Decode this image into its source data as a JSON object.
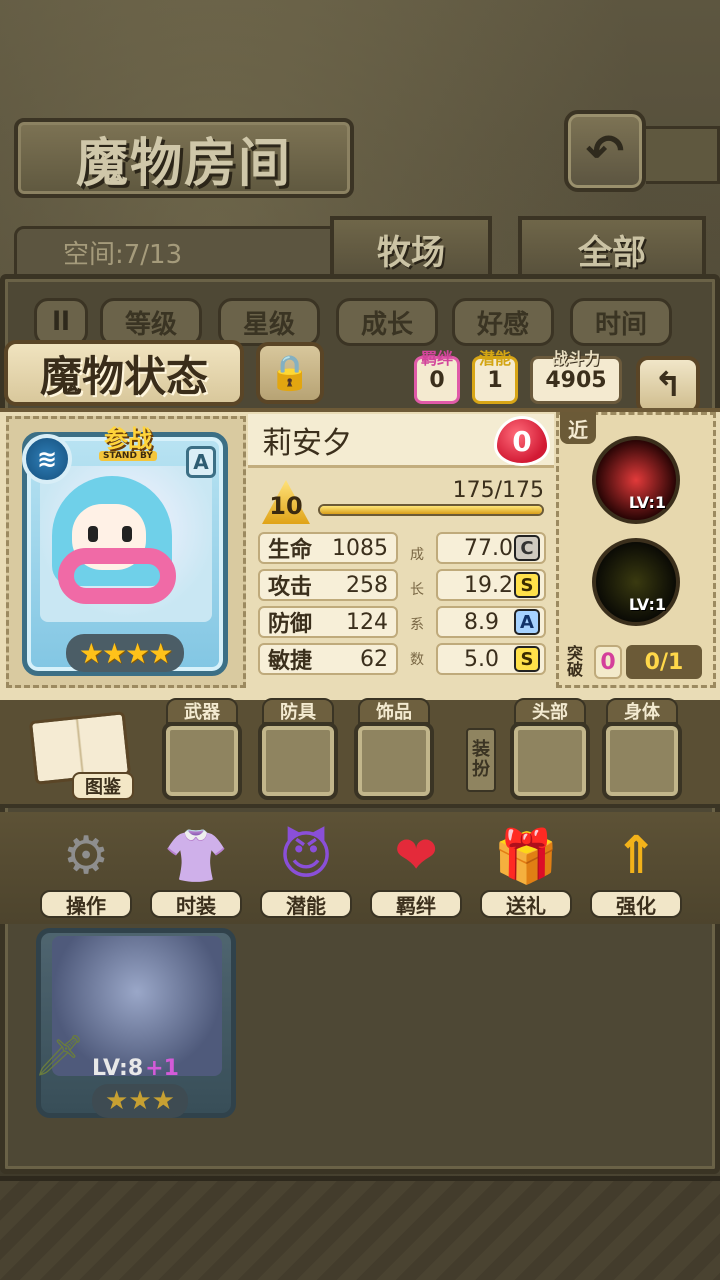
{
  "title": "魔物房间",
  "space": "空间:7/13",
  "tabs": {
    "ranch": "牧场",
    "all": "全部"
  },
  "sort_buttons": [
    "等级",
    "星级",
    "成长",
    "好感",
    "时间"
  ],
  "status_title": "魔物状态",
  "bond": {
    "label": "羁绊",
    "value": "0"
  },
  "potential": {
    "label": "潜能",
    "value": "1"
  },
  "power": {
    "label": "战斗力",
    "value": "4905"
  },
  "card": {
    "standby_cn": "参战",
    "standby_en": "STAND BY",
    "rank": "A",
    "stars": "★★★★"
  },
  "monster": {
    "name": "莉安夕",
    "affection": "0",
    "level": "10",
    "hp": "175/175",
    "hp_fraction": 1.0,
    "stats": [
      {
        "label": "生命",
        "value": "1085"
      },
      {
        "label": "攻击",
        "value": "258"
      },
      {
        "label": "防御",
        "value": "124"
      },
      {
        "label": "敏捷",
        "value": "62"
      }
    ],
    "growth_label": [
      "成",
      "长",
      "系",
      "数"
    ],
    "growth": [
      {
        "value": "77.0",
        "grade": "C"
      },
      {
        "value": "19.2",
        "grade": "S"
      },
      {
        "value": "8.9",
        "grade": "A"
      },
      {
        "value": "5.0",
        "grade": "S"
      }
    ]
  },
  "skills": {
    "near_label": "近",
    "skill1_lv": "LV:1",
    "skill2_lv": "LV:1",
    "break_label": "突破",
    "break_value": "0",
    "break_progress": "0/1"
  },
  "equipment": {
    "codex": "图鉴",
    "slots": [
      "武器",
      "防具",
      "饰品",
      "头部",
      "身体"
    ],
    "dress_label": [
      "装",
      "扮"
    ]
  },
  "actions": [
    "操作",
    "时装",
    "潜能",
    "羁绊",
    "送礼",
    "强化"
  ],
  "bg_card": {
    "level": "LV:8",
    "plus": "+1",
    "stars": "★★★"
  }
}
